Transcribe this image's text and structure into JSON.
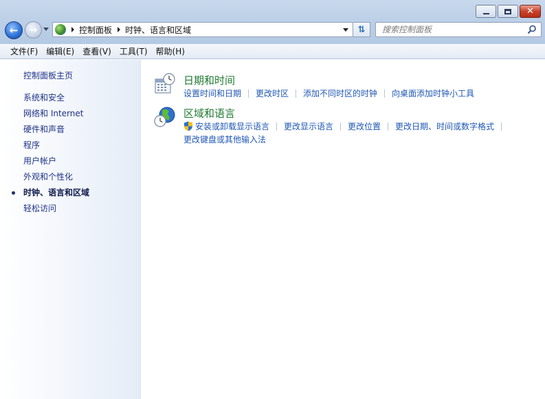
{
  "window": {
    "caption_minimize": "—",
    "caption_maximize": "□",
    "caption_close": "✕"
  },
  "nav": {
    "back_icon": "arrow-left-icon",
    "forward_icon": "arrow-right-icon"
  },
  "address": {
    "crumbs": [
      "控制面板",
      "时钟、语言和区域"
    ]
  },
  "search": {
    "placeholder": "搜索控制面板"
  },
  "menubar": {
    "items": [
      "文件(F)",
      "编辑(E)",
      "查看(V)",
      "工具(T)",
      "帮助(H)"
    ]
  },
  "sidebar": {
    "home": "控制面板主页",
    "items": [
      {
        "label": "系统和安全",
        "active": false
      },
      {
        "label": "网络和 Internet",
        "active": false
      },
      {
        "label": "硬件和声音",
        "active": false
      },
      {
        "label": "程序",
        "active": false
      },
      {
        "label": "用户帐户",
        "active": false
      },
      {
        "label": "外观和个性化",
        "active": false
      },
      {
        "label": "时钟、语言和区域",
        "active": true
      },
      {
        "label": "轻松访问",
        "active": false
      }
    ]
  },
  "main": {
    "categories": [
      {
        "title": "日期和时间",
        "icon": "calendar-clock-icon",
        "links": [
          "设置时间和日期",
          "更改时区",
          "添加不同时区的时钟",
          "向桌面添加时钟小工具"
        ]
      },
      {
        "title": "区域和语言",
        "icon": "globe-clock-icon",
        "links": [
          "安装或卸载显示语言",
          "更改显示语言",
          "更改位置",
          "更改日期、时间或数字格式",
          "更改键盘或其他输入法"
        ]
      }
    ]
  },
  "colors": {
    "category_title": "#1e7a2f",
    "link": "#1f57b6",
    "sidebar_link": "#1e3287"
  }
}
